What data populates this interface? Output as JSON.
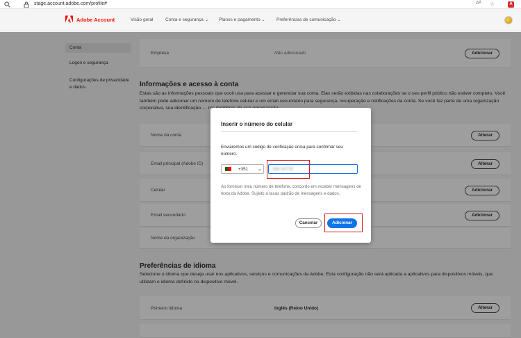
{
  "browser": {
    "url": "stage.account.adobe.com/profile#",
    "reader_icon": "Aᴬ",
    "star_icon": "☆"
  },
  "nav": {
    "brand": "Adobe Account",
    "items": [
      {
        "label": "Visão geral",
        "dropdown": false
      },
      {
        "label": "Conta e segurança",
        "dropdown": true
      },
      {
        "label": "Planos e pagamento",
        "dropdown": true
      },
      {
        "label": "Preferências de comunicação",
        "dropdown": true
      }
    ]
  },
  "sidebar": {
    "items": [
      {
        "label": "Conta",
        "active": true
      },
      {
        "label": "Logon e segurança",
        "active": false
      },
      {
        "label": "Configurações de privacidade e dados",
        "active": false
      }
    ]
  },
  "company_row": {
    "label": "Empresa",
    "value": "Não adicionado",
    "button": "Adicionar"
  },
  "account_section": {
    "title": "Informações e acesso à conta",
    "text": "Estas são as informações pessoais que você usa para acessar e gerenciar sua conta. Elas serão exibidas nas colaborações se o seu perfil público não estiver completo. Você também pode adicionar um número de telefone celular e um email secundário para segurança, recuperação e notificações da conta. Se você faz parte de uma organização corporativa, sua identificação … ros membros de sua organização.",
    "rows": [
      {
        "label": "Nome da conta",
        "button": "Alterar"
      },
      {
        "label": "Email principal (Adobe ID)",
        "button": "Alterar"
      },
      {
        "label": "Celular",
        "button": "Adicionar"
      },
      {
        "label": "Email secundário",
        "button": "Adicionar"
      },
      {
        "label": "Nome da organização",
        "button": ""
      }
    ]
  },
  "language_section": {
    "title": "Preferências de idioma",
    "text": "Selecione o idioma que deseja usar nos aplicativos, serviços e comunicações da Adobe. Esta configuração não será aplicada a aplicativos para dispositivos móveis, que utilizam o idioma definido no dispositivo móvel.",
    "rows": [
      {
        "label": "Primeiro idioma",
        "value": "Inglês (Reino Unido)",
        "button": "Alterar"
      }
    ]
  },
  "modal": {
    "title": "Inserir o número do celular",
    "description": "Enviaremos um código de verificação única para confirmar seu número.",
    "country_code": "+351",
    "phone_value": "286 00778",
    "legal": "Ao fornecer meu número de telefone, concordo em receber mensagens de texto da Adobe. Sujeito a taxas padrão de mensagens e dados.",
    "cancel_label": "Cancelar",
    "add_label": "Adicionar"
  },
  "colors": {
    "accent": "#1473e6",
    "brand": "#fa0f00",
    "highlight": "#d71920"
  }
}
